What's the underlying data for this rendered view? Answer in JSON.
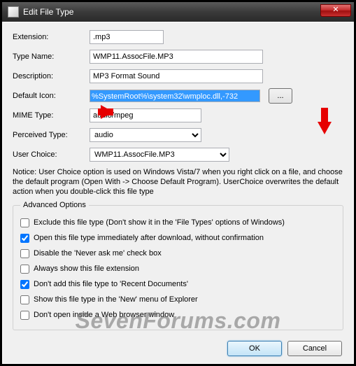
{
  "title": "Edit File Type",
  "closeGlyph": "✕",
  "labels": {
    "extension": "Extension:",
    "typeName": "Type Name:",
    "description": "Description:",
    "defaultIcon": "Default Icon:",
    "mimeType": "MIME Type:",
    "perceivedType": "Perceived Type:",
    "userChoice": "User Choice:"
  },
  "values": {
    "extension": ".mp3",
    "typeName": "WMP11.AssocFile.MP3",
    "description": "MP3 Format Sound",
    "defaultIcon": "%SystemRoot%\\system32\\wmploc.dll,-732",
    "mimeType": "audio/mpeg",
    "perceivedType": "audio",
    "userChoice": "WMP11.AssocFile.MP3"
  },
  "browseLabel": "...",
  "notice": "Notice: User Choice option is used on Windows Vista/7 when you right click on a file, and choose the default program (Open With -> Choose Default Program). UserChoice overwrites the default action when you double-click this file type",
  "advanced": {
    "legend": "Advanced Options",
    "options": [
      {
        "label": "Exclude  this file type (Don't show it in the 'File Types' options of Windows)",
        "checked": false
      },
      {
        "label": "Open this file type immediately after download, without confirmation",
        "checked": true
      },
      {
        "label": "Disable the 'Never ask me' check box",
        "checked": false
      },
      {
        "label": "Always show this file extension",
        "checked": false
      },
      {
        "label": "Don't add this file type to 'Recent Documents'",
        "checked": true
      },
      {
        "label": "Show this file type in the 'New' menu of Explorer",
        "checked": false
      },
      {
        "label": "Don't open inside a Web browser window",
        "checked": false
      }
    ]
  },
  "buttons": {
    "ok": "OK",
    "cancel": "Cancel"
  },
  "watermark": "SevenForums.com"
}
